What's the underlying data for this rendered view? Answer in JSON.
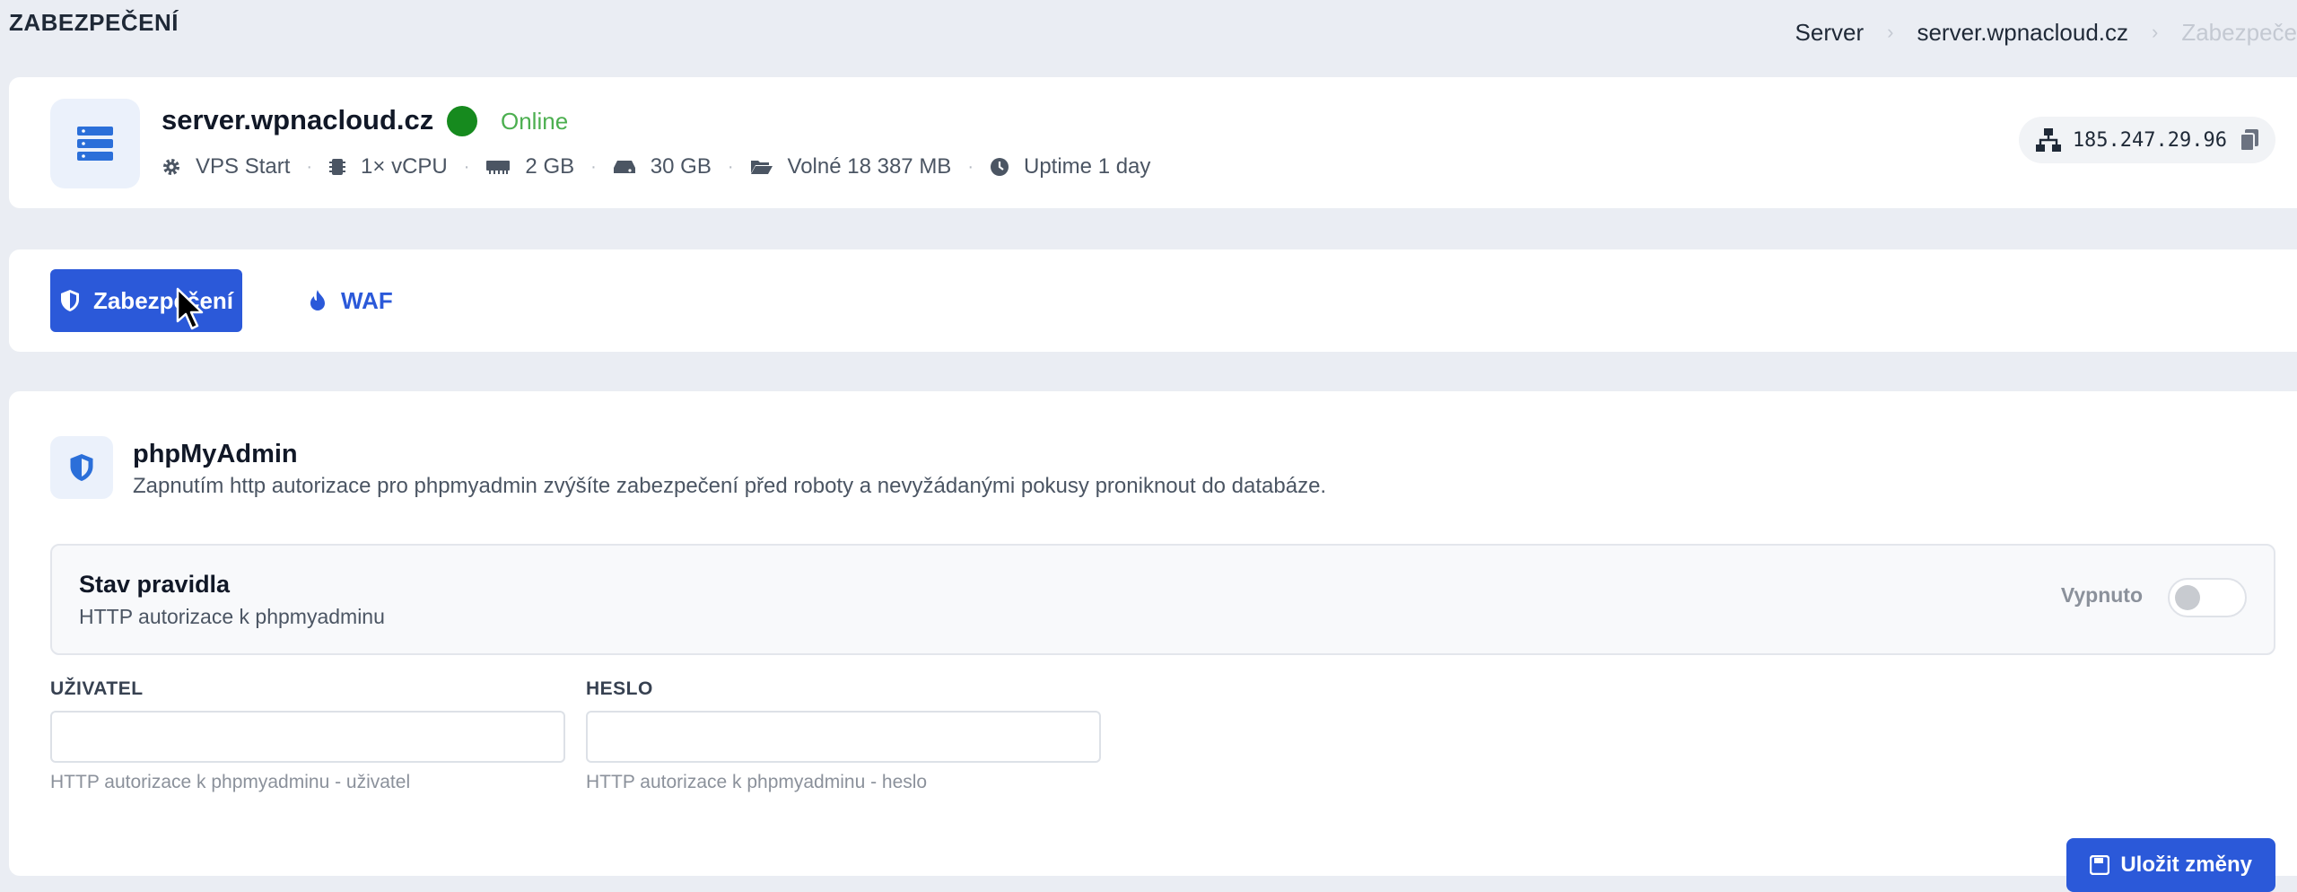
{
  "page": {
    "title": "ZABEZPEČENÍ"
  },
  "breadcrumb": [
    "Server",
    "server.wpnacloud.cz",
    "Zabezpeče"
  ],
  "server": {
    "name": "server.wpnacloud.cz",
    "status": "Online",
    "status_color": "#168a1e",
    "specs": {
      "plan": "VPS Start",
      "cpu": "1× vCPU",
      "ram": "2 GB",
      "disk": "30 GB",
      "free": "Volné 18 387 MB",
      "uptime": "Uptime 1 day"
    },
    "ip": "185.247.29.96"
  },
  "tabs": [
    {
      "label": "Zabezpečení",
      "active": true,
      "icon": "shield-icon"
    },
    {
      "label": "WAF",
      "active": false,
      "icon": "flame-icon"
    }
  ],
  "section": {
    "title": "phpMyAdmin",
    "description": "Zapnutím http autorizace pro phpmyadmin zvýšíte zabezpečení před roboty a nevyžádanými pokusy proniknout do databáze."
  },
  "rule": {
    "title": "Stav pravidla",
    "subtitle": "HTTP autorizace k phpmyadminu",
    "state_label": "Vypnuto",
    "enabled": false
  },
  "form": {
    "user_label": "UŽIVATEL",
    "user_value": "",
    "user_help": "HTTP autorizace k phpmyadminu - uživatel",
    "password_label": "HESLO",
    "password_value": "",
    "password_help": "HTTP autorizace k phpmyadminu - heslo"
  },
  "actions": {
    "save_label": "Uložit změny"
  },
  "colors": {
    "accent": "#2b59d9",
    "online": "#4caf50",
    "background": "#eaedf3"
  }
}
